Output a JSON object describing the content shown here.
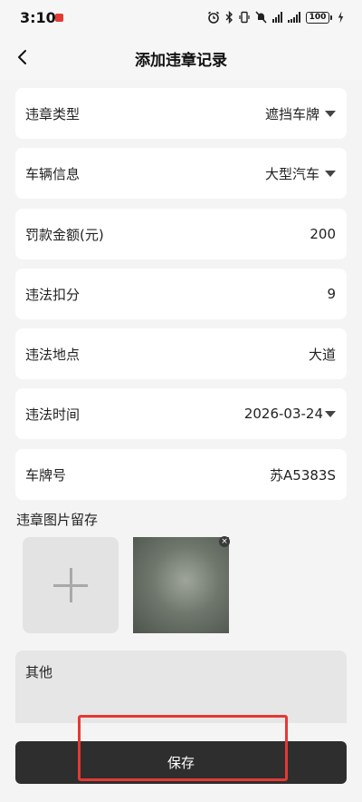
{
  "status_bar": {
    "time": "3:10",
    "battery": "100",
    "icons": [
      "alarm-icon",
      "bluetooth-icon",
      "vibrate-icon",
      "mute-icon",
      "signal-icon",
      "signal-icon",
      "battery-icon",
      "charging-icon"
    ]
  },
  "header": {
    "title": "添加违章记录",
    "back_icon": "chevron-left-icon"
  },
  "form": {
    "fields": [
      {
        "label": "违章类型",
        "value": "遮挡车牌",
        "dropdown": true
      },
      {
        "label": "车辆信息",
        "value": "大型汽车",
        "dropdown": true
      },
      {
        "label": "罚款金额(元)",
        "value": "200",
        "dropdown": false
      },
      {
        "label": "违法扣分",
        "value": "9",
        "dropdown": false
      },
      {
        "label": "违法地点",
        "value": "大道",
        "dropdown": false
      },
      {
        "label": "违法时间",
        "value": "2026-03-24",
        "dropdown": true
      },
      {
        "label": "车牌号",
        "value": "苏A5383S",
        "dropdown": false
      }
    ],
    "photos": {
      "label": "违章图片留存",
      "remove_symbol": "×"
    },
    "other": {
      "placeholder": "其他"
    }
  },
  "footer": {
    "save_label": "保存"
  },
  "colors": {
    "highlight": "#e53935",
    "save_button": "#2e2e2e",
    "background": "#f4f4f4"
  }
}
